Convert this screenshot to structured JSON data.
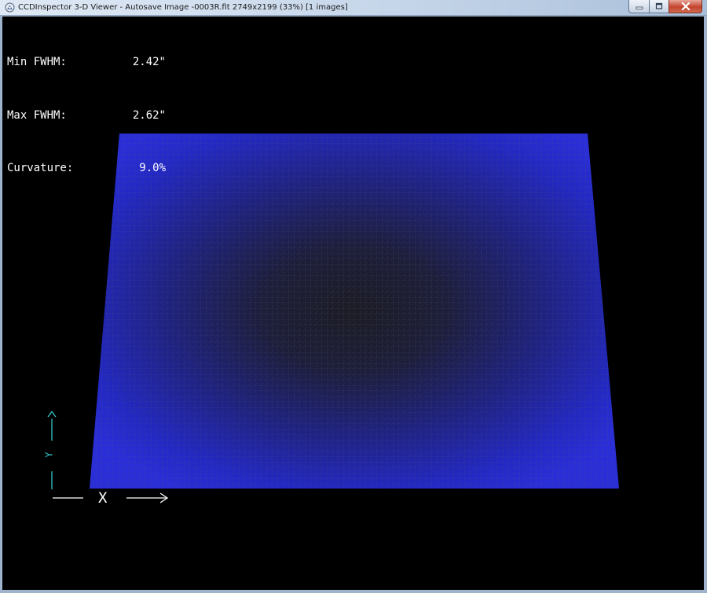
{
  "window": {
    "title": "CCDInspector 3-D Viewer - Autosave Image -0003R.fit 2749x2199 (33%)  [1 images]",
    "app_icon": "ccdinspector-app-icon",
    "controls": {
      "minimize_icon": "minimize-icon",
      "maximize_icon": "maximize-icon",
      "close_icon": "close-icon"
    }
  },
  "stats": [
    {
      "label": "Min FWHM:",
      "value": "2.42\""
    },
    {
      "label": "Max FWHM:",
      "value": "2.62\""
    },
    {
      "label": "Curvature:",
      "value": "9.0%"
    }
  ],
  "axes": {
    "x_label": "X",
    "y_label": "Y",
    "x_color": "#ffffff",
    "y_color": "#33c6c9"
  },
  "surface": {
    "type": "3d-mesh-plot",
    "edge_color": "#2a2fd0",
    "center_color": "#1c1c24",
    "background": "#000000"
  }
}
